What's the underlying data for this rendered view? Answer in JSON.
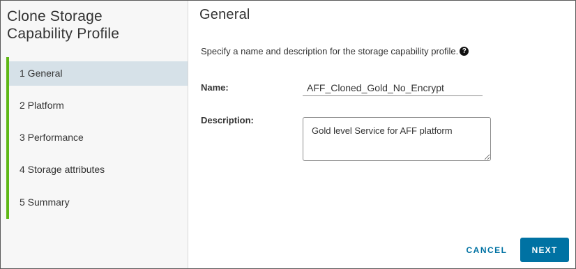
{
  "wizard": {
    "title_line1": "Clone Storage",
    "title_line2": "Capability Profile",
    "steps": [
      {
        "label": "1 General",
        "active": true
      },
      {
        "label": "2 Platform",
        "active": false
      },
      {
        "label": "3 Performance",
        "active": false
      },
      {
        "label": "4 Storage attributes",
        "active": false
      },
      {
        "label": "5 Summary",
        "active": false
      }
    ],
    "accent_color": "#5eb715"
  },
  "page": {
    "title": "General",
    "intro": "Specify a name and description for the storage capability profile.",
    "help_icon": "question-circle-icon"
  },
  "form": {
    "name_label": "Name:",
    "name_value": "AFF_Cloned_Gold_No_Encrypt",
    "description_label": "Description:",
    "description_value": "Gold level Service for AFF platform"
  },
  "footer": {
    "cancel_label": "CANCEL",
    "next_label": "NEXT",
    "primary_color": "#0072a3"
  }
}
